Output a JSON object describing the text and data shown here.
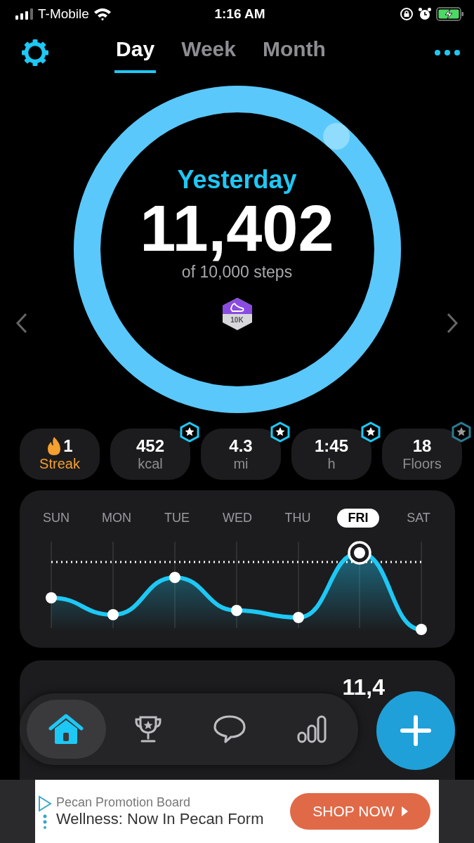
{
  "status_bar": {
    "carrier": "T-Mobile",
    "time": "1:16 AM"
  },
  "tabs": [
    {
      "label": "Day",
      "selected": true
    },
    {
      "label": "Week",
      "selected": false
    },
    {
      "label": "Month",
      "selected": false
    }
  ],
  "ring": {
    "title": "Yesterday",
    "value": "11,402",
    "caption": "of 10,000 steps",
    "level": 1,
    "badge": "10K"
  },
  "stats": [
    {
      "kind": "streak",
      "value": "1",
      "label": "Streak"
    },
    {
      "kind": "stat",
      "value": "452",
      "label": "kcal",
      "goal_met": true
    },
    {
      "kind": "stat",
      "value": "4.3",
      "label": "mi",
      "goal_met": true
    },
    {
      "kind": "stat",
      "value": "1:45",
      "label": "h",
      "goal_met": true
    },
    {
      "kind": "stat",
      "value": "18",
      "label": "Floors",
      "goal_met": false
    }
  ],
  "week": {
    "days": [
      {
        "label": "SUN",
        "selected": false
      },
      {
        "label": "MON",
        "selected": false
      },
      {
        "label": "TUE",
        "selected": false
      },
      {
        "label": "WED",
        "selected": false
      },
      {
        "label": "THU",
        "selected": false
      },
      {
        "label": "FRI",
        "selected": true
      },
      {
        "label": "SAT",
        "selected": false
      }
    ]
  },
  "friends_card": {
    "steps": "11,4"
  },
  "nav": [
    {
      "kind": "home",
      "selected": true
    },
    {
      "kind": "trophy",
      "selected": false
    },
    {
      "kind": "chat",
      "selected": false
    },
    {
      "kind": "stats",
      "selected": false
    }
  ],
  "ad": {
    "sponsor": "Pecan Promotion Board",
    "headline": "Wellness: Now In Pecan Form",
    "button": "SHOP NOW"
  }
}
